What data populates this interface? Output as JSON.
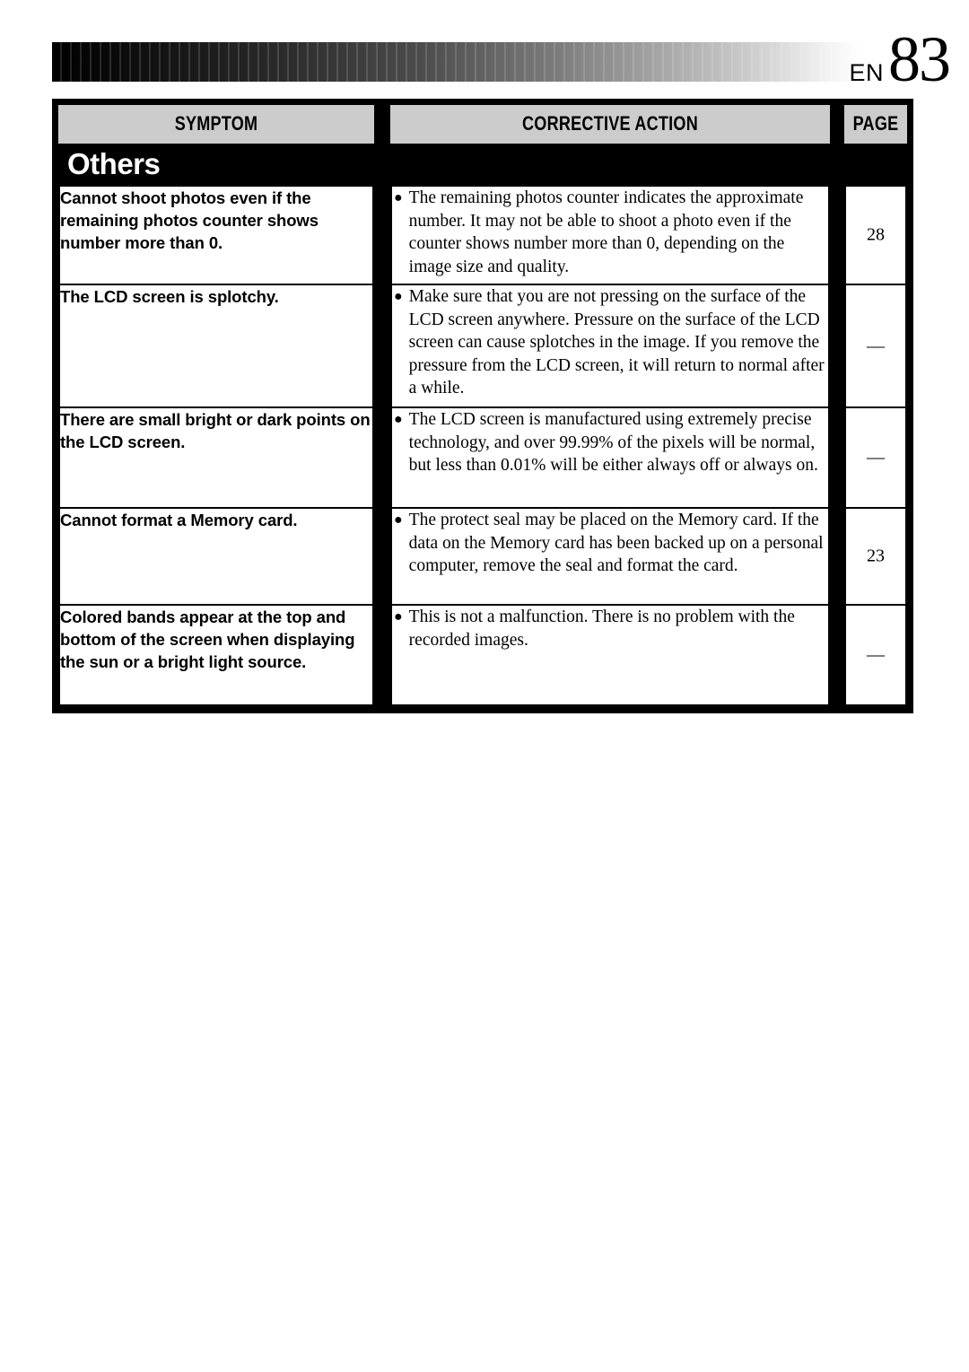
{
  "header": {
    "language_code": "EN",
    "page_number": "83",
    "gradient_bar": "grayscale-gradient-bar"
  },
  "table": {
    "columns": [
      {
        "key": "symptom",
        "label": "SYMPTOM"
      },
      {
        "key": "corrective_action",
        "label": "CORRECTIVE ACTION"
      },
      {
        "key": "page",
        "label": "PAGE"
      }
    ],
    "section_title": "Others",
    "rows": [
      {
        "symptom": "Cannot shoot photos even if the remaining photos counter shows number more than 0.",
        "corrective_action": "The remaining photos counter indicates the approximate number. It may not be able to shoot a photo even if the counter shows number more than 0, depending on the image size and quality.",
        "page": "28"
      },
      {
        "symptom": "The LCD screen is splotchy.",
        "corrective_action": "Make sure that you are not pressing on the surface of the LCD screen anywhere. Pressure on the surface of the LCD screen can cause splotches in the image. If you remove the pressure from the LCD screen, it will return to normal after a while.",
        "page": "—"
      },
      {
        "symptom": "There are small bright or dark points on the LCD screen.",
        "corrective_action": "The LCD screen is manufactured using extremely precise technology, and over 99.99% of the pixels will be normal, but less than 0.01% will be either always off or always on.",
        "page": "—"
      },
      {
        "symptom": "Cannot format a Memory card.",
        "corrective_action": "The protect seal may be placed on the Memory card. If the data on the Memory card has been backed up on a personal computer, remove the seal and format the card.",
        "page": "23"
      },
      {
        "symptom": "Colored bands appear at the top and bottom of the screen when displaying the sun or a bright light source.",
        "corrective_action": "This is not a malfunction. There is no problem with the recorded images.",
        "page": "—"
      }
    ],
    "bullet_glyph": "●"
  },
  "colors": {
    "header_fill": "#cccccc",
    "border": "#000000",
    "page_background": "#ffffff",
    "section_band": "#000000",
    "section_text": "#ffffff"
  }
}
